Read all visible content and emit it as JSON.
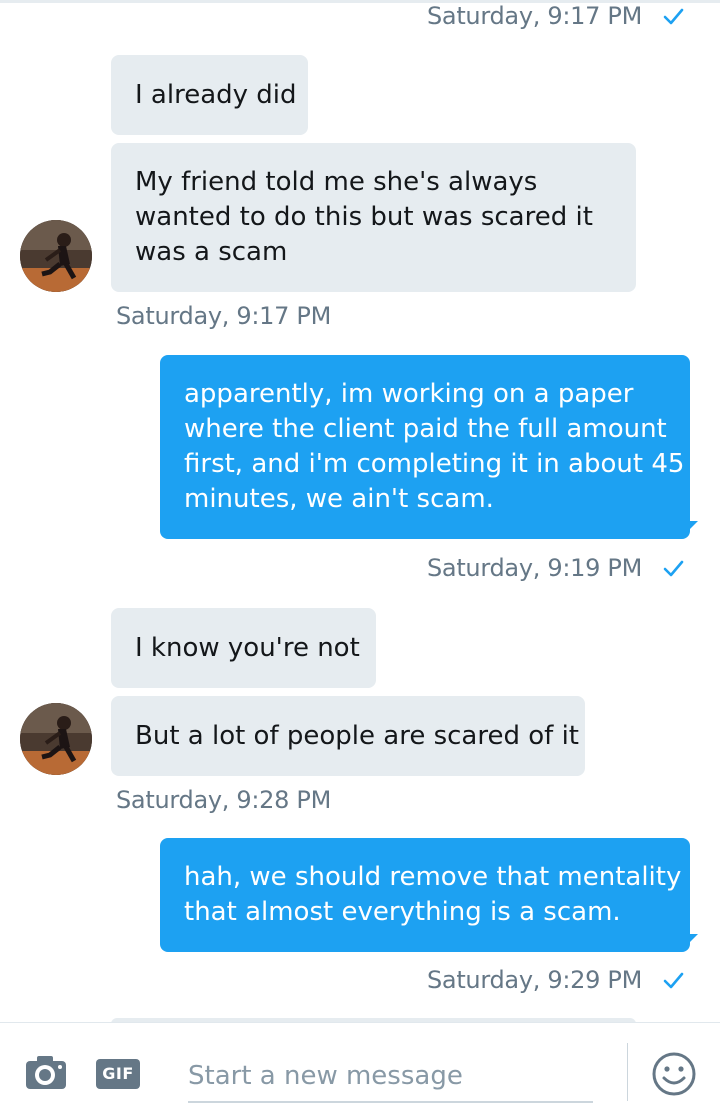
{
  "thread": {
    "messages": [
      {
        "kind": "timestamp",
        "side": "sent",
        "text": "Saturday, 9:17 PM"
      },
      {
        "kind": "bubble",
        "side": "received",
        "lines": [
          "I already did"
        ]
      },
      {
        "kind": "bubble",
        "side": "received",
        "lines": [
          "My friend told me she's always",
          "wanted to do this but was scared it",
          "was a scam"
        ]
      },
      {
        "kind": "timestamp",
        "side": "received",
        "text": "Saturday, 9:17 PM"
      },
      {
        "kind": "bubble",
        "side": "sent",
        "lines": [
          "apparently, im working on a paper",
          "where the client paid the full amount",
          "first, and i'm completing it in about 45",
          "minutes, we ain't scam."
        ]
      },
      {
        "kind": "timestamp",
        "side": "sent",
        "text": "Saturday, 9:19 PM"
      },
      {
        "kind": "bubble",
        "side": "received",
        "lines": [
          "I know you're not"
        ]
      },
      {
        "kind": "bubble",
        "side": "received",
        "lines": [
          "But a lot of people are scared of it"
        ]
      },
      {
        "kind": "timestamp",
        "side": "received",
        "text": "Saturday, 9:28 PM"
      },
      {
        "kind": "bubble",
        "side": "sent",
        "lines": [
          "hah, we should remove that mentality",
          "that almost everything is a scam."
        ]
      },
      {
        "kind": "timestamp",
        "side": "sent",
        "text": "Saturday, 9:29 PM"
      }
    ]
  },
  "composer": {
    "camera_icon": "camera-icon",
    "gif_label": "GIF",
    "placeholder": "Start a new message",
    "emoji_icon": "emoji-icon"
  },
  "colors": {
    "sent_bubble": "#1da1f2",
    "received_bubble": "#e6ecf0",
    "timestamp": "#657786",
    "read_check": "#1da1f2"
  }
}
